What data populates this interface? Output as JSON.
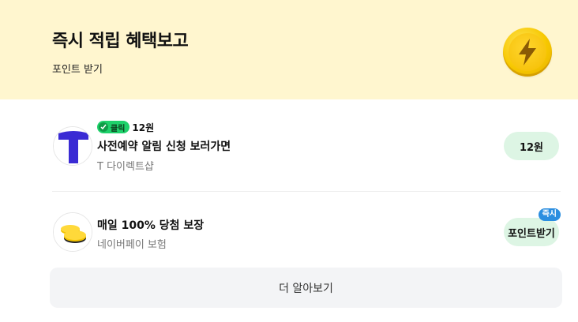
{
  "header": {
    "title": "즉시 적립 혜택보고",
    "subtitle": "포인트 받기",
    "icon": "lightning-coin-icon"
  },
  "items": [
    {
      "badge": {
        "label": "클릭",
        "icon": "cursor-click-icon"
      },
      "badge_amount": "12원",
      "title": "사전예약 알림 신청 보러가면",
      "subtitle": "T 다이렉트샵",
      "logo": "t-direct-logo",
      "action_label": "12원"
    },
    {
      "title": "매일 100% 당첨 보장",
      "subtitle": "네이버페이 보험",
      "logo": "coins-icon",
      "action_label": "포인트받기",
      "action_badge": "즉시"
    }
  ],
  "footer": {
    "more_label": "더 알아보기"
  },
  "colors": {
    "header_bg": "#fff6cf",
    "pill_bg": "#ddf5e4",
    "click_badge": "#1fd16b",
    "instant_badge": "#2b8ee0",
    "coin": "#f7c800"
  }
}
